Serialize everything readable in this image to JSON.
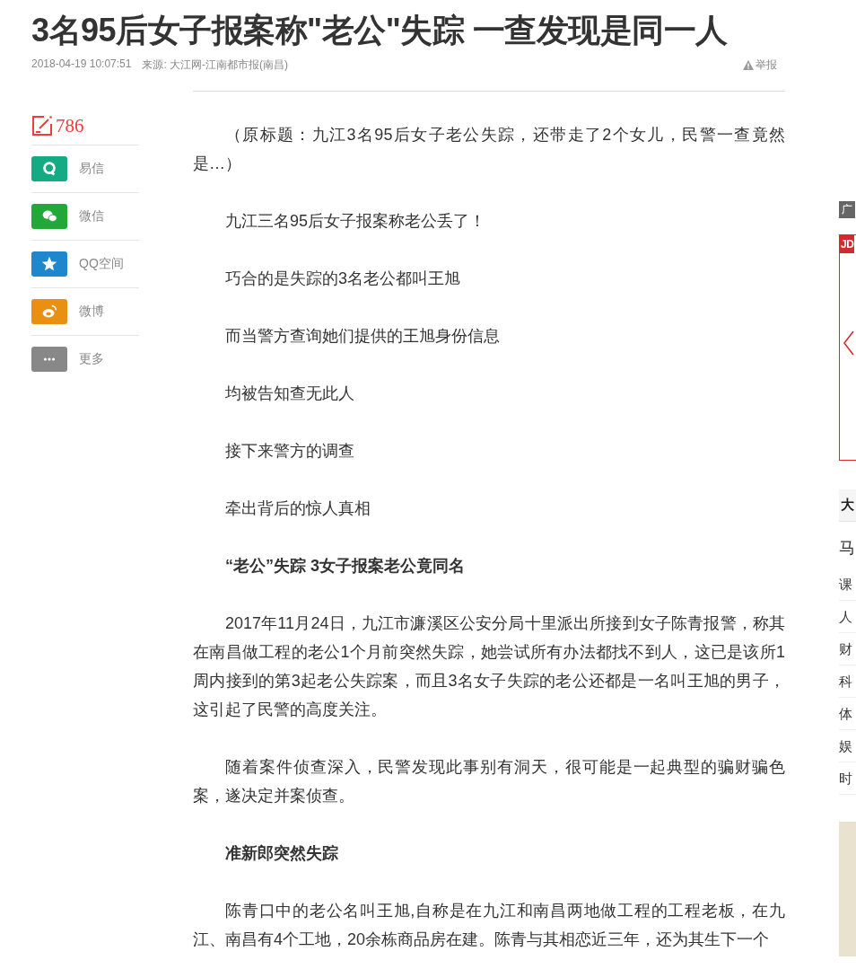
{
  "title": "3名95后女子报案称\"老公\"失踪 一查发现是同一人",
  "meta": {
    "date": "2018-04-19 10:07:51",
    "source": "来源: 大江网-江南都市报(南昌)",
    "report": "举报"
  },
  "comment_count": "786",
  "share": [
    {
      "kind": "yixin",
      "label": "易信"
    },
    {
      "kind": "wechat",
      "label": "微信"
    },
    {
      "kind": "qzone",
      "label": "QQ空间"
    },
    {
      "kind": "weibo",
      "label": "微博"
    },
    {
      "kind": "more",
      "label": "更多"
    }
  ],
  "article": [
    {
      "kind": "text",
      "text": "（原标题：九江3名95后女子老公失踪，还带走了2个女儿，民警一查竟然是…）"
    },
    {
      "kind": "text",
      "text": "九江三名95后女子报案称老公丢了！"
    },
    {
      "kind": "text",
      "text": "巧合的是失踪的3名老公都叫王旭"
    },
    {
      "kind": "text",
      "text": "而当警方查询她们提供的王旭身份信息"
    },
    {
      "kind": "text",
      "text": "均被告知查无此人"
    },
    {
      "kind": "text",
      "text": "接下来警方的调查"
    },
    {
      "kind": "text",
      "text": "牵出背后的惊人真相"
    },
    {
      "kind": "heading",
      "text": "“老公”失踪 3女子报案老公竟同名"
    },
    {
      "kind": "text",
      "text": "2017年11月24日，九江市濂溪区公安分局十里派出所接到女子陈青报警，称其在南昌做工程的老公1个月前突然失踪，她尝试所有办法都找不到人，这已是该所1周内接到的第3起老公失踪案，而且3名女子失踪的老公还都是一名叫王旭的男子，这引起了民警的高度关注。"
    },
    {
      "kind": "text",
      "text": "随着案件侦查深入，民警发现此事别有洞天，很可能是一起典型的骗财骗色案，遂决定并案侦查。"
    },
    {
      "kind": "heading",
      "text": "准新郎突然失踪"
    },
    {
      "kind": "text",
      "text": "陈青口中的老公名叫王旭,自称是在九江和南昌两地做工程的工程老板，在九江、南昌有4个工地，20余栋商品房在建。陈青与其相恋近三年，还为其生下一个"
    }
  ],
  "sidebar": {
    "ad_label": "广",
    "ad_badge": "JD",
    "tab_label": "大",
    "headline": "马",
    "items": [
      "课",
      "人",
      "财",
      "科",
      "体",
      "娱",
      "时"
    ]
  }
}
